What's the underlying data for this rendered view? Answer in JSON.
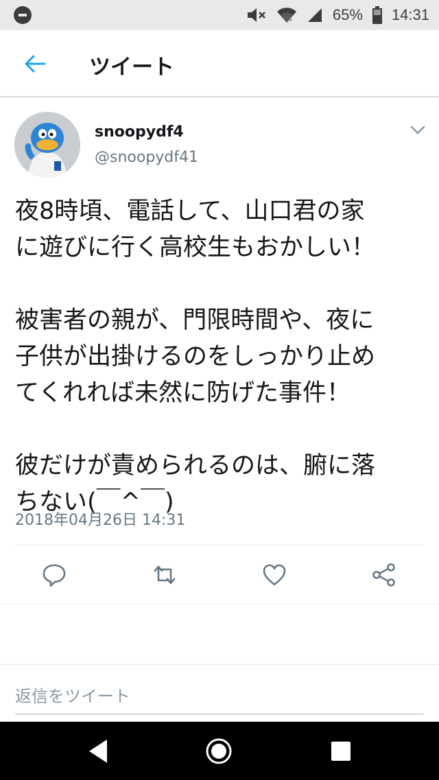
{
  "status_bar": {
    "battery": "65%",
    "time": "14:31",
    "icons": [
      "minus-circle-icon",
      "mute-icon",
      "wifi-icon",
      "signal-icon",
      "battery-icon"
    ]
  },
  "header": {
    "back_icon": "back-arrow-icon",
    "title": "ツイート"
  },
  "tweet": {
    "username": "snoopydf4",
    "handle": "@snoopydf41",
    "text": "夜8時頃、電話して、山口君の家\nに遊びに行く高校生もおかしい！\n\n被害者の親が、門限時間や、夜に\n子供が出掛けるのをしっかり止め\nてくれれば未然に防げた事件！\n\n彼だけが責められるのは、腑に落\nちない(￣^￣)",
    "timestamp": "2018年04月26日 14:31",
    "actions": [
      "reply-icon",
      "retweet-icon",
      "like-icon",
      "share-icon"
    ]
  },
  "reply": {
    "placeholder": "返信をツイート"
  },
  "colors": {
    "accent": "#1da1f2",
    "secondary_text": "#657786",
    "icon_gray": "#657786"
  }
}
